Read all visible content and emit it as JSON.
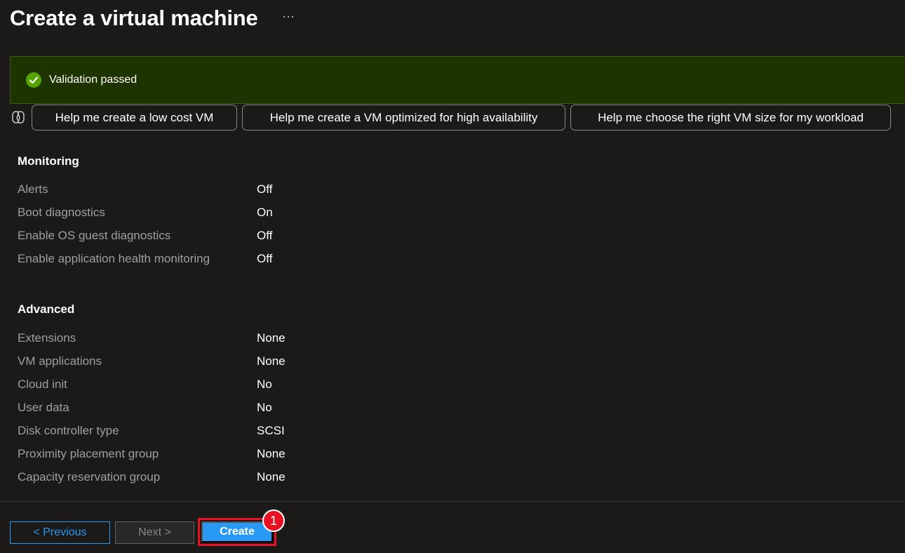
{
  "header": {
    "title": "Create a virtual machine",
    "more_label": "···"
  },
  "validation": {
    "text": "Validation passed",
    "status_color": "#57a300",
    "icon": "check-circle-icon"
  },
  "copilot": {
    "icon": "copilot-icon",
    "prompts": [
      "Help me create a low cost VM",
      "Help me create a VM optimized for high availability",
      "Help me choose the right VM size for my workload"
    ]
  },
  "monitoring": {
    "title": "Monitoring",
    "rows": [
      {
        "label": "Alerts",
        "value": "Off"
      },
      {
        "label": "Boot diagnostics",
        "value": "On"
      },
      {
        "label": "Enable OS guest diagnostics",
        "value": "Off"
      },
      {
        "label": "Enable application health monitoring",
        "value": "Off"
      }
    ]
  },
  "advanced": {
    "title": "Advanced",
    "rows": [
      {
        "label": "Extensions",
        "value": "None"
      },
      {
        "label": "VM applications",
        "value": "None"
      },
      {
        "label": "Cloud init",
        "value": "No"
      },
      {
        "label": "User data",
        "value": "No"
      },
      {
        "label": "Disk controller type",
        "value": "SCSI"
      },
      {
        "label": "Proximity placement group",
        "value": "None"
      },
      {
        "label": "Capacity reservation group",
        "value": "None"
      }
    ]
  },
  "footer": {
    "previous_label": "< Previous",
    "next_label": "Next >",
    "create_label": "Create",
    "step_badge": "1"
  },
  "colors": {
    "accent": "#2899f5",
    "highlight": "#e81123",
    "banner_bg": "#1d3300"
  }
}
